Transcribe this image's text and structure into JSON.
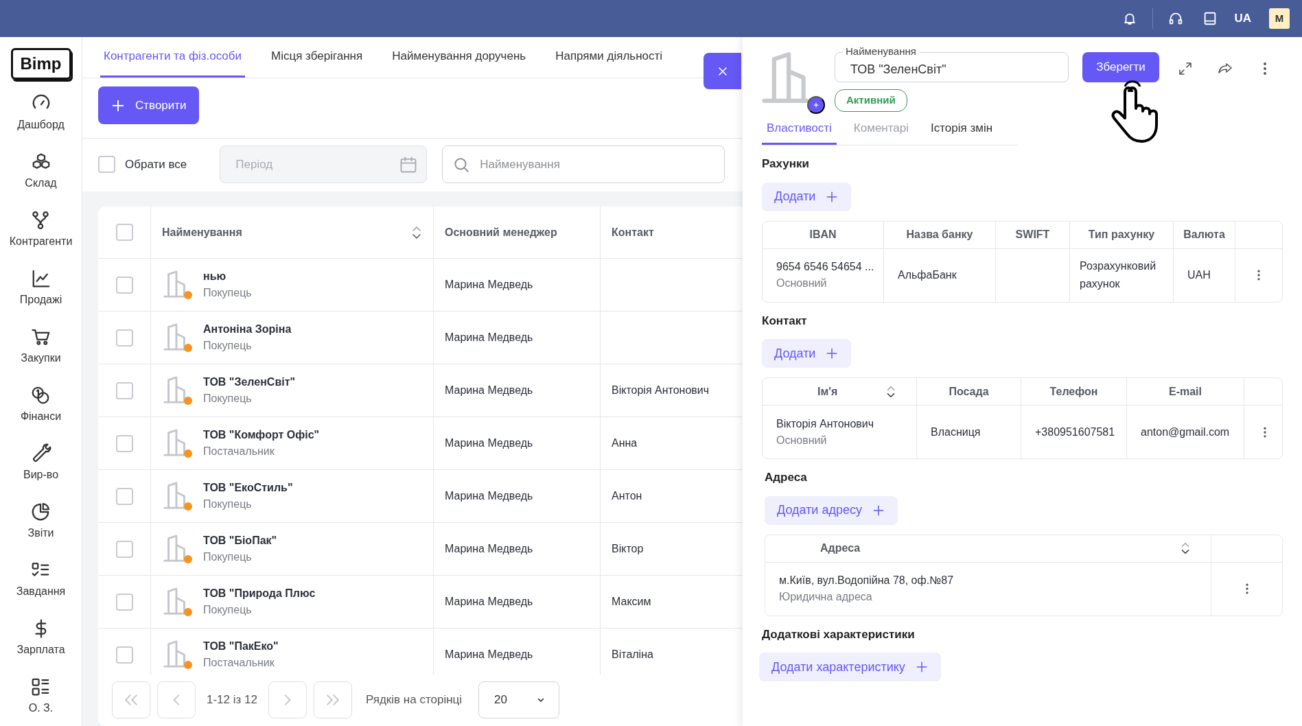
{
  "top_bar": {
    "language": "UA",
    "avatar": "M"
  },
  "sidebar": {
    "logo": "Bimp",
    "items": [
      {
        "label": "Дашборд"
      },
      {
        "label": "Склад"
      },
      {
        "label": "Контрагенти"
      },
      {
        "label": "Продажі"
      },
      {
        "label": "Закупки"
      },
      {
        "label": "Фінанси"
      },
      {
        "label": "Вир-во"
      },
      {
        "label": "Звіти"
      },
      {
        "label": "Завдання"
      },
      {
        "label": "Зарплата"
      },
      {
        "label": "О. З."
      }
    ]
  },
  "tabs": [
    {
      "label": "Контрагенти та фіз.особи",
      "selected": true
    },
    {
      "label": "Місця зберігання",
      "selected": false
    },
    {
      "label": "Найменування доручень",
      "selected": false
    },
    {
      "label": "Напрями діяльності",
      "selected": false
    }
  ],
  "create_button": "Створити",
  "filters": {
    "select_all": {
      "label": "Обрати все",
      "checked": false
    },
    "period": {
      "placeholder": "Період"
    },
    "search": {
      "placeholder": "Найменування"
    }
  },
  "table": {
    "header_checked": false,
    "columns": [
      {
        "label": "Найменування",
        "sortable": true
      },
      {
        "label": "Основний менеджер",
        "sortable": false
      },
      {
        "label": "Контакт",
        "sortable": false
      }
    ],
    "rows": [
      {
        "name": "нью",
        "type": "Покупець",
        "manager": "Марина Медведь",
        "checked": false
      },
      {
        "name": "Антоніна Зоріна",
        "type": "Покупець",
        "manager": "Марина Медведь",
        "checked": false
      },
      {
        "name": "ТОВ \"ЗеленСвіт\"",
        "type": "Покупець",
        "manager": "Марина Медведь",
        "contact": "Вікторія Антонович",
        "checked": false
      },
      {
        "name": "ТОВ \"Комфорт Офіс\"",
        "type": "Постачальник",
        "manager": "Марина Медведь",
        "contact": "Анна",
        "checked": false
      },
      {
        "name": "ТОВ \"ЕкоСтиль\"",
        "type": "Покупець",
        "manager": "Марина Медведь",
        "contact": "Антон",
        "checked": false
      },
      {
        "name": "ТОВ \"БіоПак\"",
        "type": "Покупець",
        "manager": "Марина Медведь",
        "contact": "Віктор",
        "checked": false
      },
      {
        "name": "ТОВ \"Природа Плюс",
        "type": "Покупець",
        "manager": "Марина Медведь",
        "contact": "Максим",
        "checked": false
      },
      {
        "name": "ТОВ \"ПакЕко\"",
        "type": "Постачальник",
        "manager": "Марина Медведь",
        "contact": "Віталіна",
        "checked": false
      }
    ]
  },
  "pagination": {
    "range": "1-12 із 12",
    "rows_per_page_label": "Рядків на сторінці",
    "rows_per_page": "20"
  },
  "drawer": {
    "name_field": {
      "label": "Найменування",
      "value": "ТОВ \"ЗеленСвіт\""
    },
    "save_button": "Зберегти",
    "status": "Активний",
    "tabs": [
      {
        "label": "Властивості",
        "selected": true,
        "disabled": false
      },
      {
        "label": "Коментарі",
        "selected": false,
        "disabled": true
      },
      {
        "label": "Історія змін",
        "selected": false,
        "disabled": false
      }
    ],
    "accounts": {
      "title": "Рахунки",
      "add_button": "Додати",
      "columns": [
        "IBAN",
        "Назва банку",
        "SWIFT",
        "Тип рахунку",
        "Валюта"
      ],
      "rows": [
        {
          "iban": "9654 6546 54654 ...",
          "note": "Основний",
          "bank": "АльфаБанк",
          "type": "Розрахунковий рахунок",
          "currency": "UAH"
        }
      ]
    },
    "contacts": {
      "title": "Контакт",
      "add_button": "Додати",
      "columns": [
        {
          "label": "Ім'я",
          "sortable": true
        },
        {
          "label": "Посада",
          "sortable": false
        },
        {
          "label": "Телефон",
          "sortable": false
        },
        {
          "label": "E-mail",
          "sortable": false
        }
      ],
      "rows": [
        {
          "name": "Вікторія Антонович",
          "note": "Основний",
          "position": "Власниця",
          "phone": "+380951607581",
          "email": "anton@gmail.com"
        }
      ]
    },
    "addresses": {
      "title": "Адреса",
      "add_button": "Додати адресу",
      "columns": [
        {
          "label": "Адреса",
          "sortable": true
        }
      ],
      "rows": [
        {
          "address": "м.Київ, вул.Водопійна 78, оф.№87",
          "note": "Юридична адреса"
        }
      ]
    },
    "extra": {
      "title": "Додаткові характеристики",
      "add_button": "Додати характеристику"
    }
  }
}
